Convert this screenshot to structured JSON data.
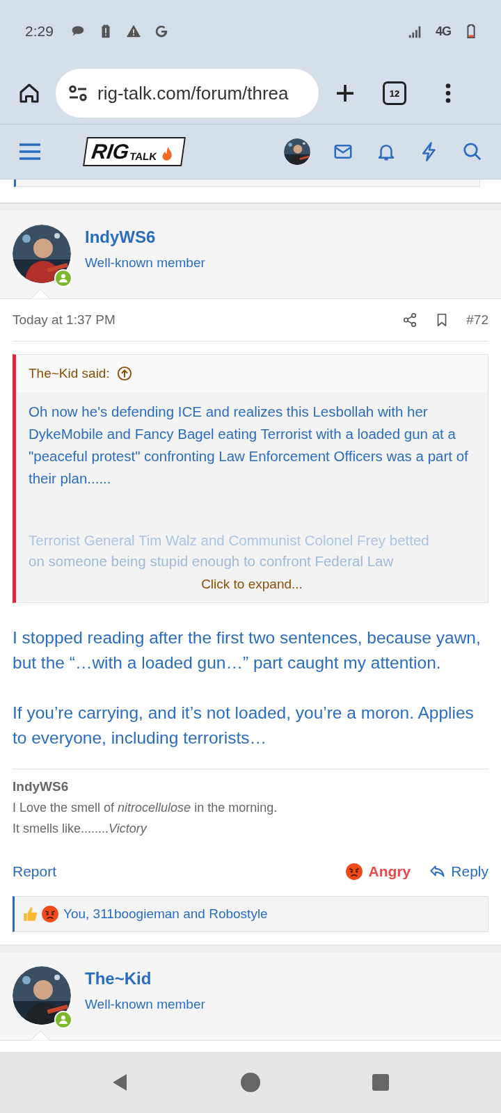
{
  "status_bar": {
    "time": "2:29",
    "network": "4G"
  },
  "browser": {
    "url": "rig-talk.com/forum/threa",
    "tab_count": "12"
  },
  "site_nav": {
    "logo_main": "RIG",
    "logo_sub": "TALK"
  },
  "posts": [
    {
      "author": "IndyWS6",
      "role": "Well-known member",
      "online": true,
      "date": "Today at 1:37 PM",
      "post_number": "#72",
      "quote": {
        "attribution": "The~Kid said:",
        "paragraphs": [
          "Oh now he's defending ICE and realizes this Lesbollah with her DykeMobile and Fancy Bagel eating Terrorist with a loaded gun at a \"peaceful protest\" confronting Law Enforcement Officers was a part of their plan......"
        ],
        "faded_lines": [
          "Terrorist General Tim Walz and Communist Colonel Frey betted",
          "on someone being stupid enough to confront Federal Law"
        ],
        "expand": "Click to expand..."
      },
      "paragraphs": [
        "I stopped reading after the first two sentences, because yawn, but the “…with a loaded gun…” part caught my attention.",
        "If you’re carrying, and it’s not loaded, you’re a moron. Applies to everyone, including terrorists…"
      ],
      "signature": {
        "name": "IndyWS6",
        "lines": [
          "I Love the smell of *nitrocellulose* in the morning.",
          "It smells like........*Victory*"
        ]
      },
      "actions": {
        "report": "Report",
        "reaction": "Angry",
        "reply": "Reply"
      },
      "reactions_summary": "You, 311boogieman and Robostyle"
    },
    {
      "author": "The~Kid",
      "role": "Well-known member",
      "online": true
    }
  ]
}
